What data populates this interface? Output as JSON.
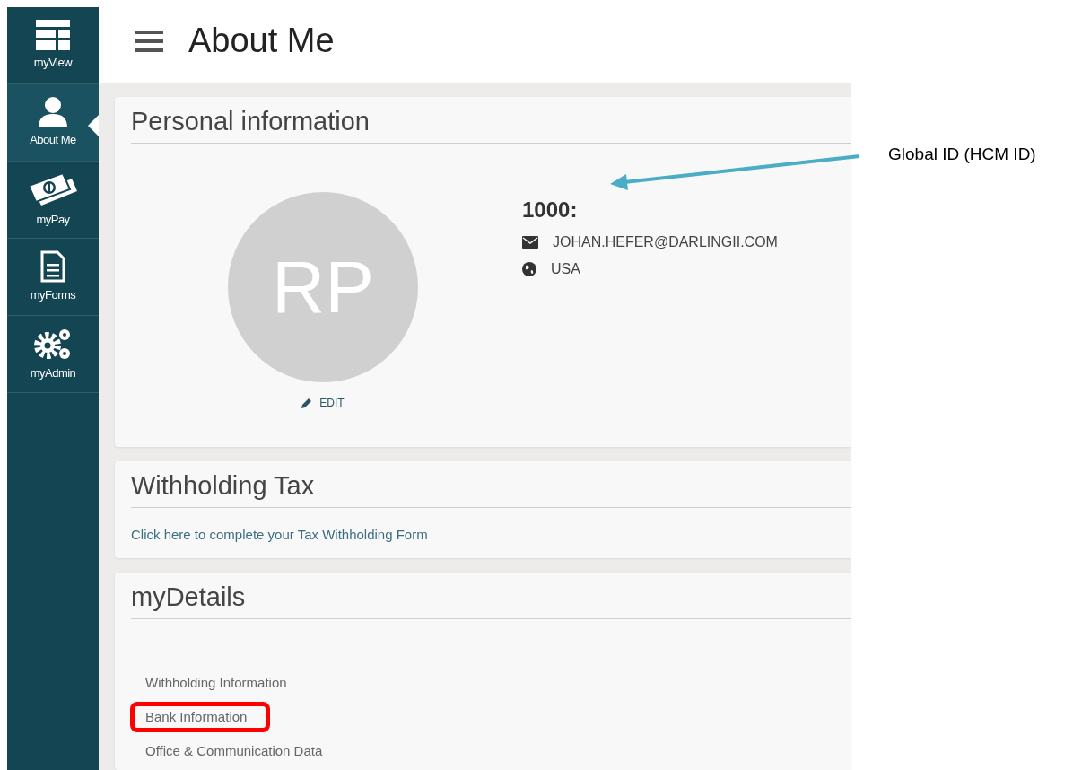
{
  "sidebar": {
    "items": [
      {
        "label": "myView",
        "kind": "grid",
        "selected": false
      },
      {
        "label": "About Me",
        "kind": "person",
        "selected": true
      },
      {
        "label": "myPay",
        "kind": "money",
        "selected": false
      },
      {
        "label": "myForms",
        "kind": "document",
        "selected": false
      },
      {
        "label": "myAdmin",
        "kind": "gears",
        "selected": false
      }
    ]
  },
  "header": {
    "title": "About Me"
  },
  "personal_information": {
    "title": "Personal information",
    "avatar_initials": "RP",
    "edit": "EDIT",
    "global_id": "1000:",
    "email": "JOHAN.HEFER@DARLINGII.COM",
    "country": "USA"
  },
  "withholding_tax": {
    "title": "Withholding Tax",
    "link": "Click here to complete your Tax Withholding Form"
  },
  "my_details": {
    "title": "myDetails",
    "items": [
      {
        "label": "Withholding Information",
        "highlighted": false
      },
      {
        "label": "Bank Information",
        "highlighted": true
      },
      {
        "label": "Office & Communication Data",
        "highlighted": false
      }
    ]
  },
  "annotation": {
    "callout": "Global ID (HCM ID)"
  }
}
